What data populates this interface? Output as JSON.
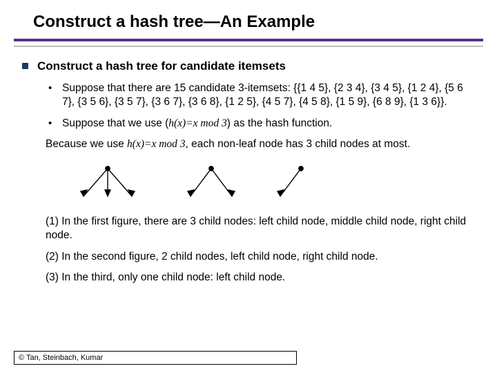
{
  "title": "Construct a hash tree—An Example",
  "heading": "Construct a hash tree for candidate itemsets",
  "bullet1": "Suppose that there are 15 candidate 3-itemsets: {{1 4 5}, {2 3 4}, {3 4 5}, {1 2 4}, {5 6 7}, {3 5 6}, {3 5 7}, {3 6 7}, {3 6 8}, {1 2 5}, {4 5 7}, {4 5 8}, {1 5 9}, {6 8 9}, {1 3 6}}.",
  "bullet2_a": "Suppose that we use (",
  "bullet2_fn": "h(x)=x mod 3",
  "bullet2_b": ") as the hash function.",
  "body1_a": "Because we use ",
  "body1_fn": "h(x)=x mod 3",
  "body1_b": ", each non-leaf node has 3 child nodes at most.",
  "body2": "(1) In the first figure, there are 3 child nodes: left child node, middle child node, right child node.",
  "body3": "(2) In the second figure, 2 child nodes, left child node, right child node.",
  "body4": "(3) In the third, only one child node: left child node.",
  "footer": "© Tan, Steinbach, Kumar"
}
